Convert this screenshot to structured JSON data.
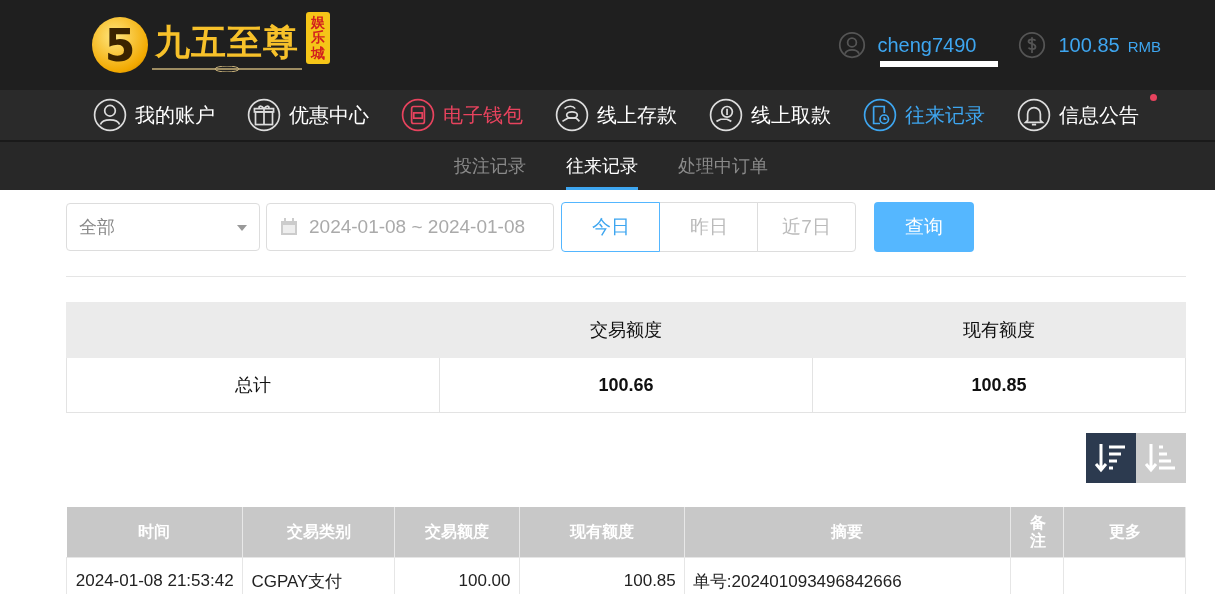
{
  "header": {
    "logo": {
      "mark": "5",
      "name": "九五至尊",
      "tag": "娱乐城"
    },
    "username": "cheng7490",
    "balance": "100.85",
    "currency": "RMB"
  },
  "nav": [
    {
      "label": "我的账户",
      "selected": false,
      "highlight": false,
      "dot": false
    },
    {
      "label": "优惠中心",
      "selected": false,
      "highlight": false,
      "dot": false
    },
    {
      "label": "电子钱包",
      "selected": false,
      "highlight": true,
      "dot": false
    },
    {
      "label": "线上存款",
      "selected": false,
      "highlight": false,
      "dot": false
    },
    {
      "label": "线上取款",
      "selected": false,
      "highlight": false,
      "dot": false
    },
    {
      "label": "往来记录",
      "selected": true,
      "highlight": false,
      "dot": false
    },
    {
      "label": "信息公告",
      "selected": false,
      "highlight": false,
      "dot": true
    }
  ],
  "subtabs": [
    {
      "label": "投注记录",
      "selected": false
    },
    {
      "label": "往来记录",
      "selected": true
    },
    {
      "label": "处理中订单",
      "selected": false
    }
  ],
  "filters": {
    "type": "全部",
    "date_range": "2024-01-08 ~ 2024-01-08",
    "ranges": [
      {
        "label": "今日",
        "selected": true
      },
      {
        "label": "昨日",
        "selected": false
      },
      {
        "label": "近7日",
        "selected": false
      }
    ],
    "query_button": "查询"
  },
  "summary": {
    "columns": [
      "交易额度",
      "现有额度"
    ],
    "row_label": "总计",
    "values": [
      "100.66",
      "100.85"
    ]
  },
  "sort": [
    {
      "selected": true
    },
    {
      "selected": false
    }
  ],
  "table": {
    "columns": [
      "时间",
      "交易类别",
      "交易额度",
      "现有额度",
      "摘要",
      "备注",
      "更多"
    ],
    "rows": [
      [
        "2024-01-08 21:53:42",
        "CGPAY支付",
        "100.00",
        "100.85",
        "单号:202401093496842666",
        "",
        ""
      ]
    ]
  }
}
